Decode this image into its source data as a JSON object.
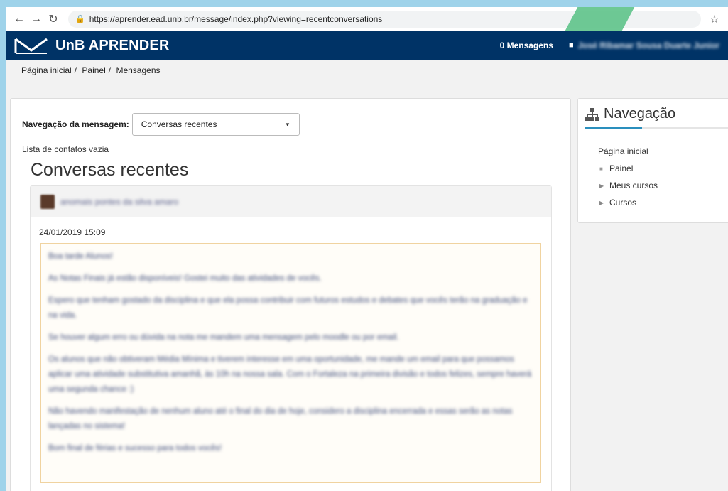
{
  "browser": {
    "url": "https://aprender.ead.unb.br/message/index.php?viewing=recentconversations"
  },
  "navbar": {
    "brand": "UnB APRENDER",
    "messages": "0 Mensagens",
    "user_name": "José Ribamar Sousa Duarte Junior"
  },
  "breadcrumb": [
    "Página inicial",
    "Painel",
    "Mensagens"
  ],
  "main": {
    "msg_nav_label": "Navegação da mensagem:",
    "select_value": "Conversas recentes",
    "contacts_empty": "Lista de contatos vazia",
    "heading": "Conversas recentes",
    "conversation": {
      "sender": "anomais pontes da silva amaro",
      "date": "24/01/2019 15:09",
      "paragraphs": [
        "Boa tarde Alunos!",
        "As Notas Finais já estão disponíveis! Gostei muito das atividades de vocês.",
        "Espero que tenham gostado da disciplina e que ela possa contribuir com futuros estudos e debates que vocês terão na graduação e na vida.",
        "Se houver algum erro ou dúvida na nota me mandem uma mensagem pelo moodle ou por email.",
        "Os alunos que não obtiveram Média Mínima e tiverem interesse em uma oportunidade, me mande um email para que possamos aplicar uma atividade substitutiva amanhã, às 10h na nossa sala. Com o Fortaleza na primeira divisão e todos felizes, sempre haverá uma segunda chance :)",
        "Não havendo manifestação de nenhum aluno até o final do dia de hoje, considero a disciplina encerrada e essas serão as notas lançadas no sistema!",
        "Bom final de férias e sucesso para todos vocês!"
      ]
    }
  },
  "sidebar": {
    "title": "Navegação",
    "home": "Página inicial",
    "items": [
      {
        "label": "Painel",
        "marker": "bullet"
      },
      {
        "label": "Meus cursos",
        "marker": "triangle"
      },
      {
        "label": "Cursos",
        "marker": "triangle"
      }
    ]
  },
  "colors": {
    "navbar": "#003366",
    "accent": "#2a8fbd",
    "background": "#9fd3ea"
  }
}
